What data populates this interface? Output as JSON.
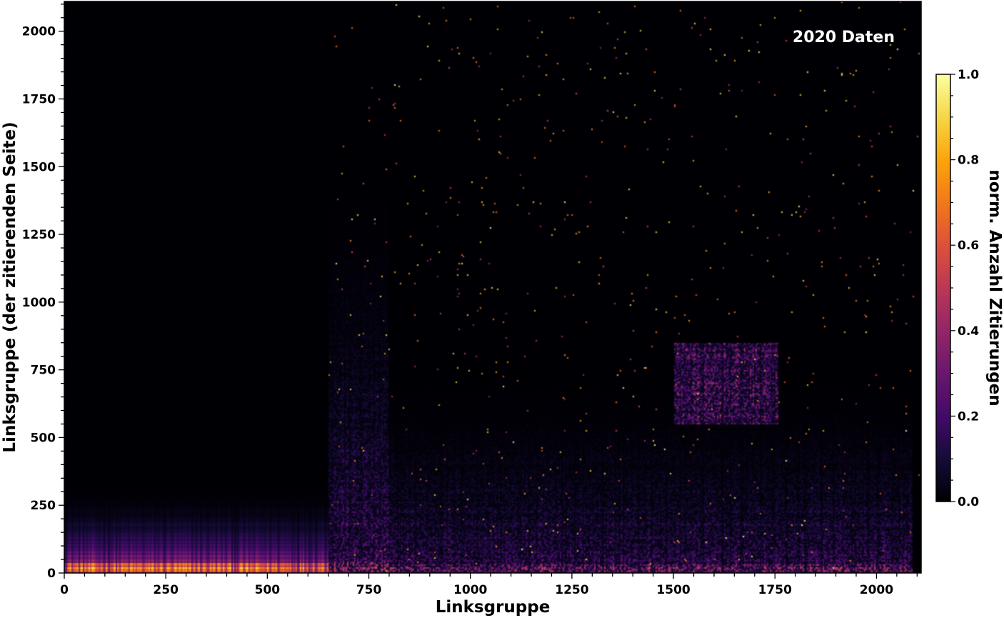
{
  "chart_data": {
    "type": "heatmap",
    "title": "",
    "annotation": "2020 Daten",
    "xlabel": "Linksgruppe",
    "ylabel": "Linksgruppe (der zitierenden Seite)",
    "xlim": [
      0,
      2110
    ],
    "ylim": [
      0,
      2110
    ],
    "x_ticks": [
      0,
      250,
      500,
      750,
      1000,
      1250,
      1500,
      1750,
      2000
    ],
    "y_ticks": [
      0,
      250,
      500,
      750,
      1000,
      1250,
      1500,
      1750,
      2000
    ],
    "grid": false,
    "colormap": "inferno",
    "colorbar": {
      "label": "norm. Anzahl Zitierungen",
      "range": [
        0.0,
        1.0
      ],
      "ticks": [
        "0.0",
        "0.2",
        "0.4",
        "0.6",
        "0.8",
        "1.0"
      ]
    },
    "intensity_profile": [
      {
        "x_range": [
          0,
          650
        ],
        "bright_band_y": [
          0,
          35
        ],
        "peak_value": 1.0,
        "fade_to_y": 350
      },
      {
        "x_range": [
          650,
          800
        ],
        "bright_band_y": [
          0,
          40
        ],
        "peak_value": 0.7,
        "fade_to_y": 1720
      },
      {
        "x_range": [
          800,
          2090
        ],
        "bright_band_y": [
          0,
          30
        ],
        "peak_value": 0.6,
        "fade_to_y": 850
      },
      {
        "x_range": [
          1500,
          1760
        ],
        "bright_band_y": [
          550,
          850
        ],
        "peak_value": 0.55,
        "fade_to_y": 850
      }
    ]
  },
  "colors": {
    "background": "#000004",
    "low": "#1b0c41",
    "mid": "#bc3754",
    "high": "#fcffa4"
  }
}
